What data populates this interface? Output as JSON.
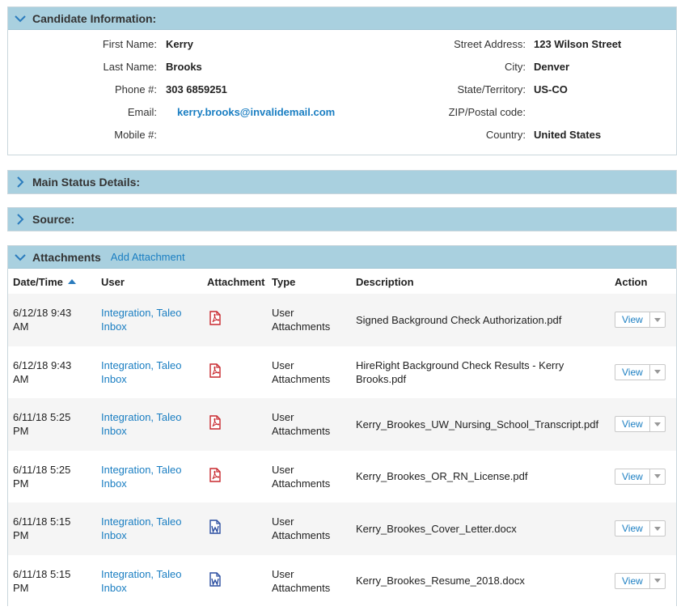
{
  "candidate": {
    "title": "Candidate Information:",
    "left": [
      {
        "label": "First Name:",
        "value": "Kerry"
      },
      {
        "label": "Last Name:",
        "value": "Brooks"
      },
      {
        "label": "Phone #:",
        "value": "303 6859251"
      },
      {
        "label": "Email:",
        "value": "kerry.brooks@invalidemail.com"
      },
      {
        "label": "Mobile #:",
        "value": ""
      }
    ],
    "right": [
      {
        "label": "Street Address:",
        "value": "123 Wilson Street"
      },
      {
        "label": "City:",
        "value": "Denver"
      },
      {
        "label": "State/Territory:",
        "value": "US-CO"
      },
      {
        "label": "ZIP/Postal code:",
        "value": ""
      },
      {
        "label": "Country:",
        "value": "United States"
      }
    ]
  },
  "main_status": {
    "title": "Main Status Details:"
  },
  "source": {
    "title": "Source:"
  },
  "attachments": {
    "title": "Attachments",
    "add_label": "Add Attachment",
    "columns": [
      "Date/Time",
      "User",
      "Attachment",
      "Type",
      "Description",
      "Action"
    ],
    "view_label": "View",
    "rows": [
      {
        "date": "6/12/18 9:43",
        "ampm": "AM",
        "user1": "Integration, Taleo",
        "user2": "Inbox",
        "icon": "pdf-icon",
        "type1": "User",
        "type2": "Attachments",
        "desc": "Signed Background Check Authorization.pdf"
      },
      {
        "date": "6/12/18 9:43",
        "ampm": "AM",
        "user1": "Integration, Taleo",
        "user2": "Inbox",
        "icon": "pdf-icon",
        "type1": "User",
        "type2": "Attachments",
        "desc": "HireRight Background Check Results - Kerry Brooks.pdf"
      },
      {
        "date": "6/11/18 5:25",
        "ampm": "PM",
        "user1": "Integration, Taleo",
        "user2": "Inbox",
        "icon": "pdf-icon",
        "type1": "User",
        "type2": "Attachments",
        "desc": "Kerry_Brookes_UW_Nursing_School_Transcript.pdf"
      },
      {
        "date": "6/11/18 5:25",
        "ampm": "PM",
        "user1": "Integration, Taleo",
        "user2": "Inbox",
        "icon": "pdf-icon",
        "type1": "User",
        "type2": "Attachments",
        "desc": "Kerry_Brookes_OR_RN_License.pdf"
      },
      {
        "date": "6/11/18 5:15",
        "ampm": "PM",
        "user1": "Integration, Taleo",
        "user2": "Inbox",
        "icon": "word-icon",
        "type1": "User",
        "type2": "Attachments",
        "desc": "Kerry_Brookes_Cover_Letter.docx"
      },
      {
        "date": "6/11/18 5:15",
        "ampm": "PM",
        "user1": "Integration, Taleo",
        "user2": "Inbox",
        "icon": "word-icon",
        "type1": "User",
        "type2": "Attachments",
        "desc": "Kerry_Brookes_Resume_2018.docx"
      }
    ]
  },
  "colors": {
    "header_bg": "#a9d0df",
    "link": "#1a7ec2",
    "pdf": "#c8282e",
    "word": "#2b4ea0"
  }
}
